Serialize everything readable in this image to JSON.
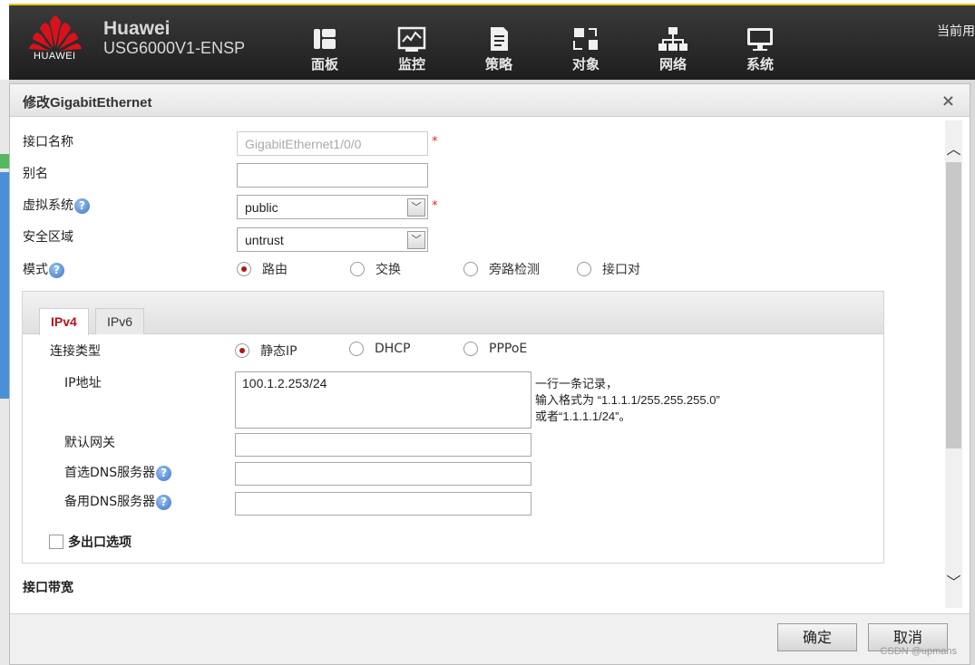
{
  "header": {
    "logo_text": "HUAWEI",
    "brand": "Huawei",
    "model": "USG6000V1-ENSP",
    "current_user": "当前用",
    "nav": [
      {
        "label": "面板",
        "icon": "dashboard-icon"
      },
      {
        "label": "监控",
        "icon": "monitor-icon"
      },
      {
        "label": "策略",
        "icon": "policy-icon"
      },
      {
        "label": "对象",
        "icon": "object-icon"
      },
      {
        "label": "网络",
        "icon": "network-icon"
      },
      {
        "label": "系统",
        "icon": "system-icon"
      }
    ]
  },
  "dialog": {
    "title": "修改GigabitEthernet",
    "close": "×",
    "fields": {
      "interface_name": {
        "label": "接口名称",
        "value": "GigabitEthernet1/0/0"
      },
      "alias": {
        "label": "别名",
        "value": ""
      },
      "vsys": {
        "label": "虚拟系统",
        "value": "public"
      },
      "zone": {
        "label": "安全区域",
        "value": "untrust"
      },
      "mode": {
        "label": "模式",
        "options": [
          "路由",
          "交换",
          "旁路检测",
          "接口对"
        ],
        "selected": "路由"
      }
    },
    "required_mark": "*",
    "help_mark": "?",
    "tabs": [
      "IPv4",
      "IPv6"
    ],
    "active_tab": "IPv4",
    "ipv4": {
      "conn_type_label": "连接类型",
      "conn_types": [
        "静态IP",
        "DHCP",
        "PPPoE"
      ],
      "conn_selected": "静态IP",
      "ip_label": "IP地址",
      "ip_value": "100.1.2.253/24",
      "hint_lines": [
        "一行一条记录，",
        "输入格式为 “1.1.1.1/255.255.255.0”",
        "或者“1.1.1.1/24”。"
      ],
      "gateway_label": "默认网关",
      "dns1_label": "首选DNS服务器",
      "dns2_label": "备用DNS服务器",
      "multi_exit_label": "多出口选项"
    },
    "bandwidth_section": "接口带宽",
    "buttons": {
      "ok": "确定",
      "cancel": "取消"
    },
    "watermark": "CSDN @upmans"
  },
  "colors": {
    "accent": "#b0151b",
    "header_bg": "#2b2b2b",
    "help": "#3a74c7"
  }
}
